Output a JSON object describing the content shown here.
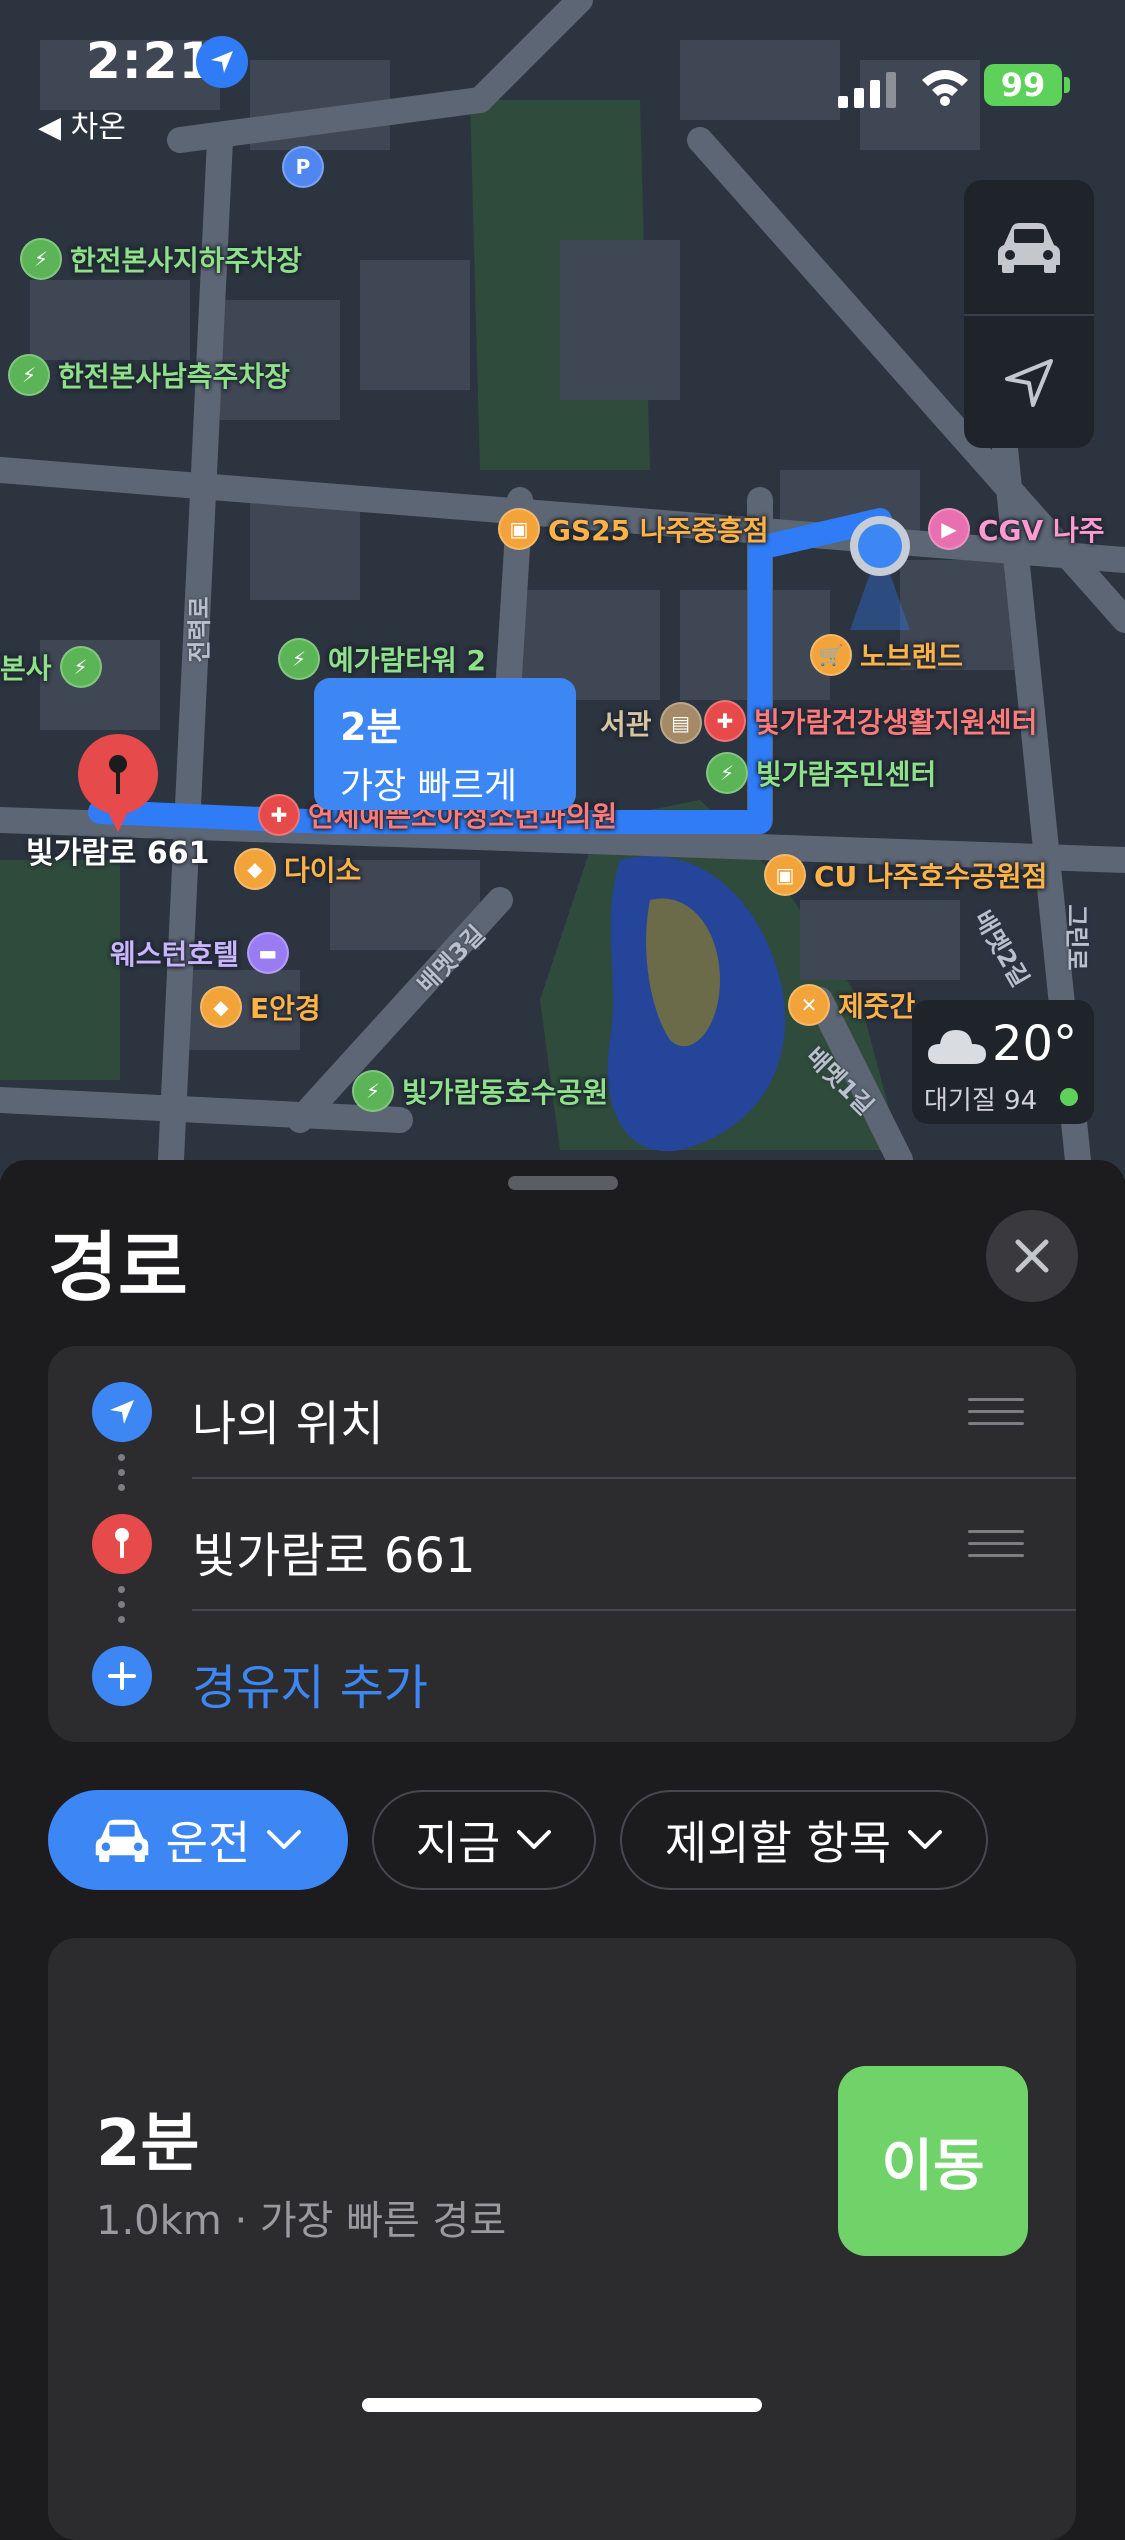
{
  "status_bar": {
    "time": "2:21",
    "back_label": "◀ 차온",
    "battery": "99"
  },
  "map": {
    "pois": [
      {
        "label": "한전본사지하주차장",
        "kind": "ev-charger"
      },
      {
        "label": "한전본사남측주차장",
        "kind": "ev-charger"
      },
      {
        "label": "GS25 나주중흥점",
        "kind": "convenience-store"
      },
      {
        "label": "CGV 나주",
        "kind": "cinema"
      },
      {
        "label": "본사",
        "kind": "ev-charger"
      },
      {
        "label": "예가람타워 2",
        "kind": "ev-charger"
      },
      {
        "label": "노브랜드",
        "kind": "shopping"
      },
      {
        "label": "서관",
        "kind": "library"
      },
      {
        "label": "빛가람건강생활지원센터",
        "kind": "hospital"
      },
      {
        "label": "빛가람주민센터",
        "kind": "ev-charger"
      },
      {
        "label": "연세예쁜소아청소년과의원",
        "kind": "hospital"
      },
      {
        "label": "다이소",
        "kind": "shopping"
      },
      {
        "label": "CU 나주호수공원점",
        "kind": "convenience-store"
      },
      {
        "label": "웨스턴호텔",
        "kind": "hotel"
      },
      {
        "label": "E안경",
        "kind": "shopping"
      },
      {
        "label": "제줏간",
        "kind": "restaurant"
      },
      {
        "label": "빛가람동호수공원",
        "kind": "ev-charger"
      },
      {
        "label": "P",
        "kind": "parking"
      }
    ],
    "road_labels": [
      "전력로",
      "배멧3길",
      "배멧2길",
      "배멧1길",
      "그린로"
    ],
    "destination_label": "빛가람로 661",
    "route_callout": {
      "duration": "2분",
      "tag": "가장 빠르게"
    },
    "weather": {
      "temperature": "20°",
      "air_quality": "대기질 94",
      "icon": "cloud-icon"
    }
  },
  "sheet": {
    "title": "경로",
    "waypoints": [
      {
        "label": "나의 위치",
        "icon": "location-arrow-icon"
      },
      {
        "label": "빛가람로 661",
        "icon": "map-pin-icon"
      }
    ],
    "add_stop_label": "경유지 추가",
    "chips": {
      "mode": "운전",
      "time": "지금",
      "exclude": "제외할 항목"
    },
    "route": {
      "duration": "2분",
      "details": "1.0km · 가장 빠른 경로",
      "go_label": "이동"
    }
  },
  "colors": {
    "accent": "#3d87f5",
    "go": "#6fd36a",
    "destination": "#e64a4a",
    "battery": "#5ed15a"
  }
}
